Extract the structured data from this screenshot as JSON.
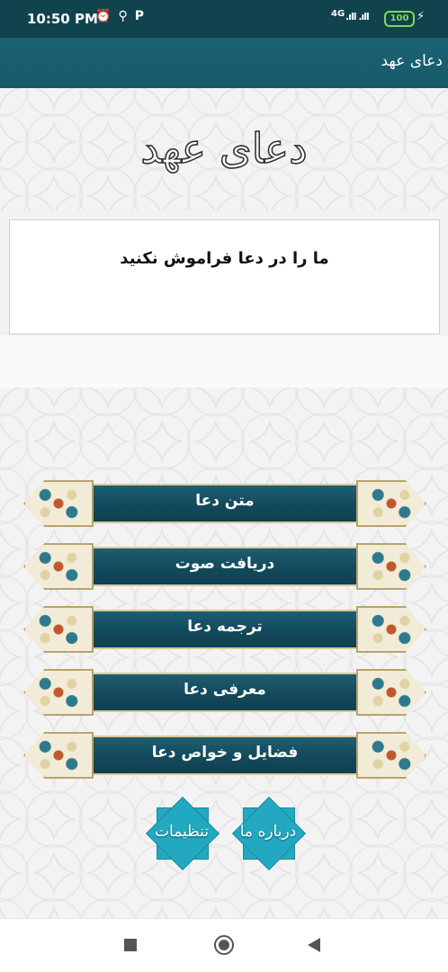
{
  "status_bar": {
    "time": "10:50 PM",
    "icons": [
      "alarm-icon",
      "usb-icon",
      "p-icon"
    ],
    "icon_glyphs": [
      "⏰",
      "⚲",
      "P"
    ],
    "network": "4G",
    "signal": ".ıll .ıll",
    "battery": "100",
    "charging": "⚡"
  },
  "app_bar": {
    "title": "دعای عهد"
  },
  "header": {
    "logo_text": "دعای عهد"
  },
  "message": {
    "text": "ما را در دعا فراموش نکنید"
  },
  "menu": {
    "items": [
      {
        "label": "متن دعا"
      },
      {
        "label": "دریافت صوت"
      },
      {
        "label": "ترجمه دعا"
      },
      {
        "label": "معرفی دعا"
      },
      {
        "label": "فضایل و خواص دعا"
      }
    ]
  },
  "actions": {
    "about_label": "درباره ما",
    "settings_label": "تنظیمات"
  },
  "colors": {
    "app_bar": "#1c6373",
    "status_bar": "#11434e",
    "menu_button": "#134a5b",
    "star_button": "#22a9c1",
    "battery": "#7ed957"
  }
}
